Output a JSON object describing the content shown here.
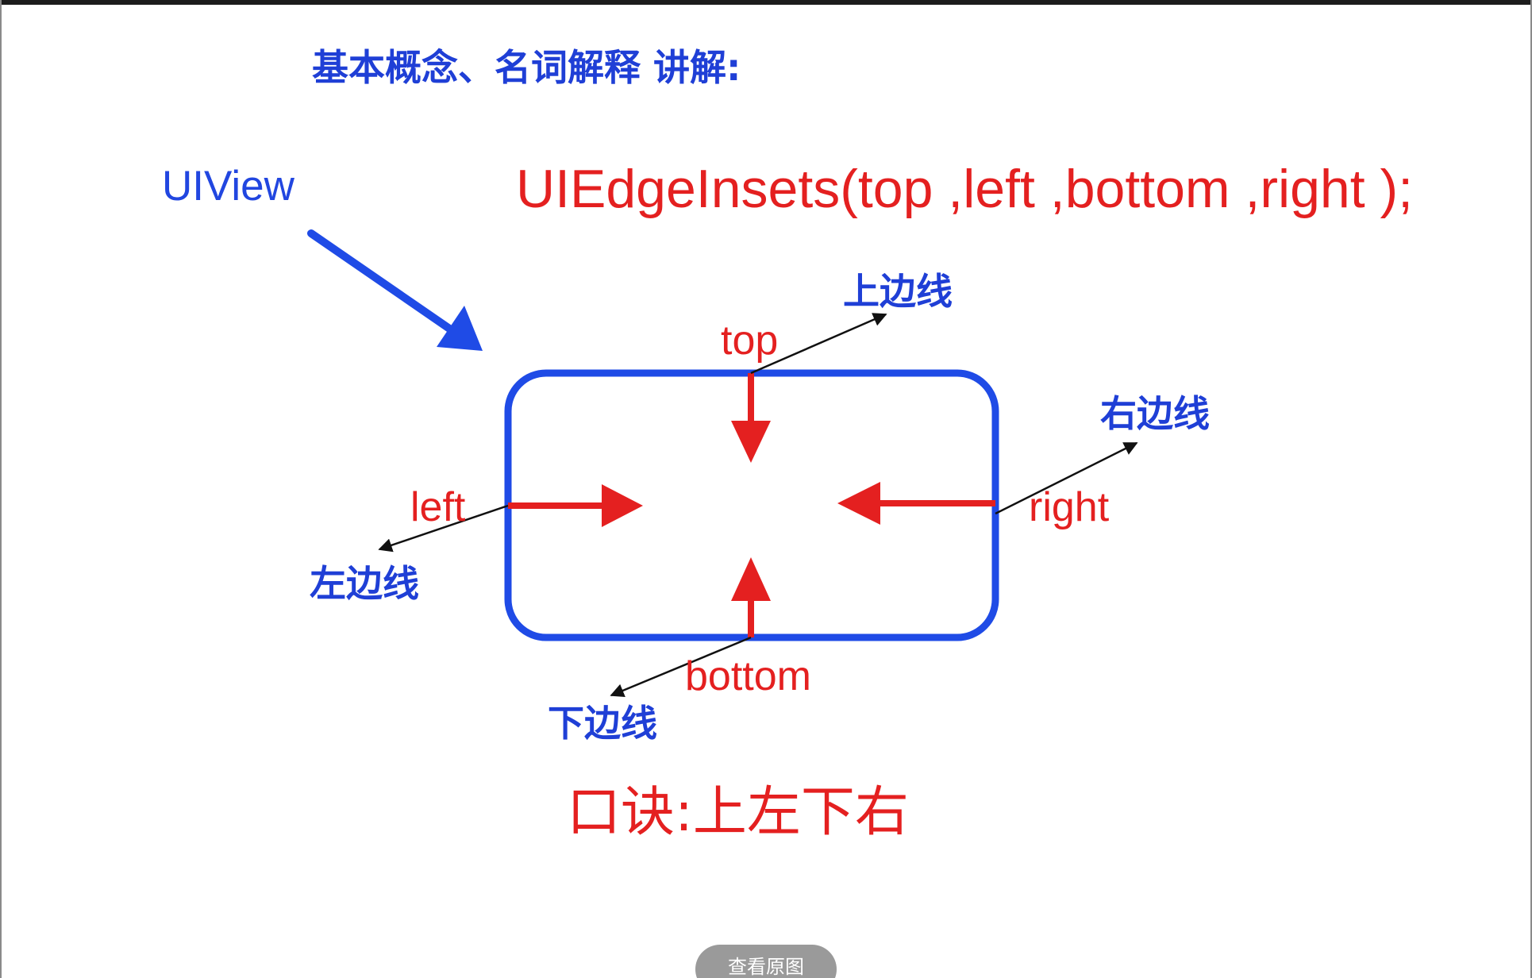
{
  "heading": "基本概念、名词解释 讲解:",
  "uiview_label": "UIView",
  "formula": "UIEdgeInsets(top ,left ,bottom ,right );",
  "edges": {
    "top": {
      "param": "top",
      "name": "上边线"
    },
    "left": {
      "param": "left",
      "name": "左边线"
    },
    "bottom": {
      "param": "bottom",
      "name": "下边线"
    },
    "right": {
      "param": "right",
      "name": "右边线"
    }
  },
  "mnemonic": "口诀:上左下右",
  "view_original_button": "查看原图",
  "colors": {
    "blue": "#1f3fd6",
    "red": "#e42020",
    "black": "#111111"
  }
}
